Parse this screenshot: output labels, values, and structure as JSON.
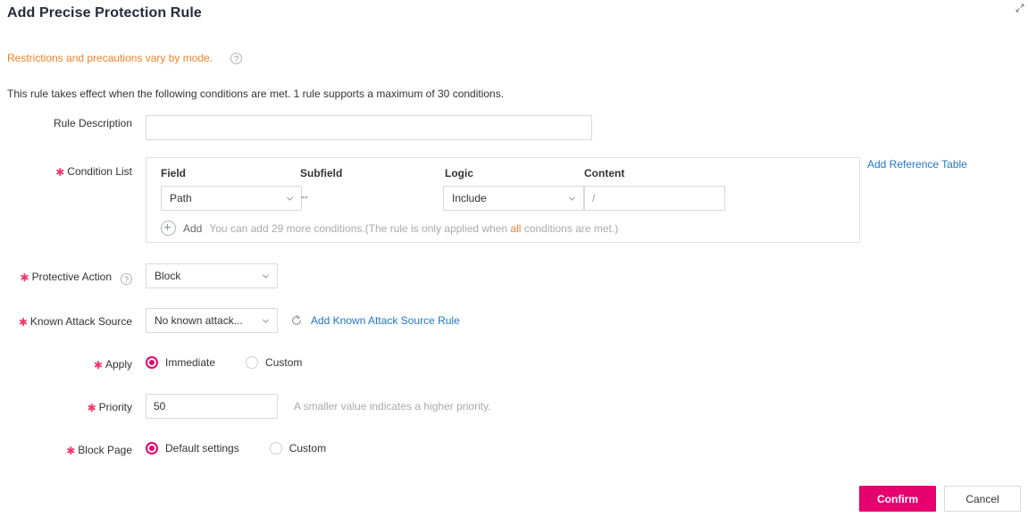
{
  "window": {
    "resize_icon": "resize-diagonal-icon"
  },
  "header": {
    "title": "Add Precise Protection Rule"
  },
  "notice": {
    "text": "Restrictions and precautions vary by mode.",
    "help_icon": "question-circle-icon",
    "color": "#f08228"
  },
  "intro": {
    "text": "This rule takes effect when the following conditions are met. 1 rule supports a maximum of 30 conditions."
  },
  "form": {
    "rule_description": {
      "label": "Rule Description",
      "required": false,
      "value": "",
      "placeholder": ""
    },
    "condition_list": {
      "label": "Condition List",
      "required": true,
      "columns": [
        "Field",
        "Subfield",
        "Logic",
        "Content"
      ],
      "rows": [
        {
          "field": "Path",
          "subfield": "--",
          "logic": "Include",
          "content": "/"
        }
      ],
      "add": {
        "icon": "plus-circle-icon",
        "label": "Add",
        "hint_before": "You can add 29 more conditions.(The rule is only applied when ",
        "hint_em": "all",
        "hint_after": " conditions are met.)"
      },
      "reference_link": "Add Reference Table"
    },
    "protective_action": {
      "label": "Protective Action",
      "required": true,
      "help_icon": "question-circle-icon",
      "value": "Block"
    },
    "known_attack_source": {
      "label": "Known Attack Source",
      "required": true,
      "value": "No known attack...",
      "refresh_icon": "refresh-icon",
      "link": "Add Known Attack Source Rule"
    },
    "apply": {
      "label": "Apply",
      "required": true,
      "selected": "Immediate",
      "options": [
        "Immediate",
        "Custom"
      ]
    },
    "priority": {
      "label": "Priority",
      "required": true,
      "value": "50",
      "hint": "A smaller value indicates a higher priority."
    },
    "block_page": {
      "label": "Block Page",
      "required": true,
      "selected": "Default settings",
      "options": [
        "Default settings",
        "Custom"
      ]
    }
  },
  "footer": {
    "confirm_label": "Confirm",
    "cancel_label": "Cancel"
  },
  "colors": {
    "accent": "#e5006d",
    "required_star": "#f5336b",
    "link": "#2077c4",
    "warning": "#f08228"
  }
}
